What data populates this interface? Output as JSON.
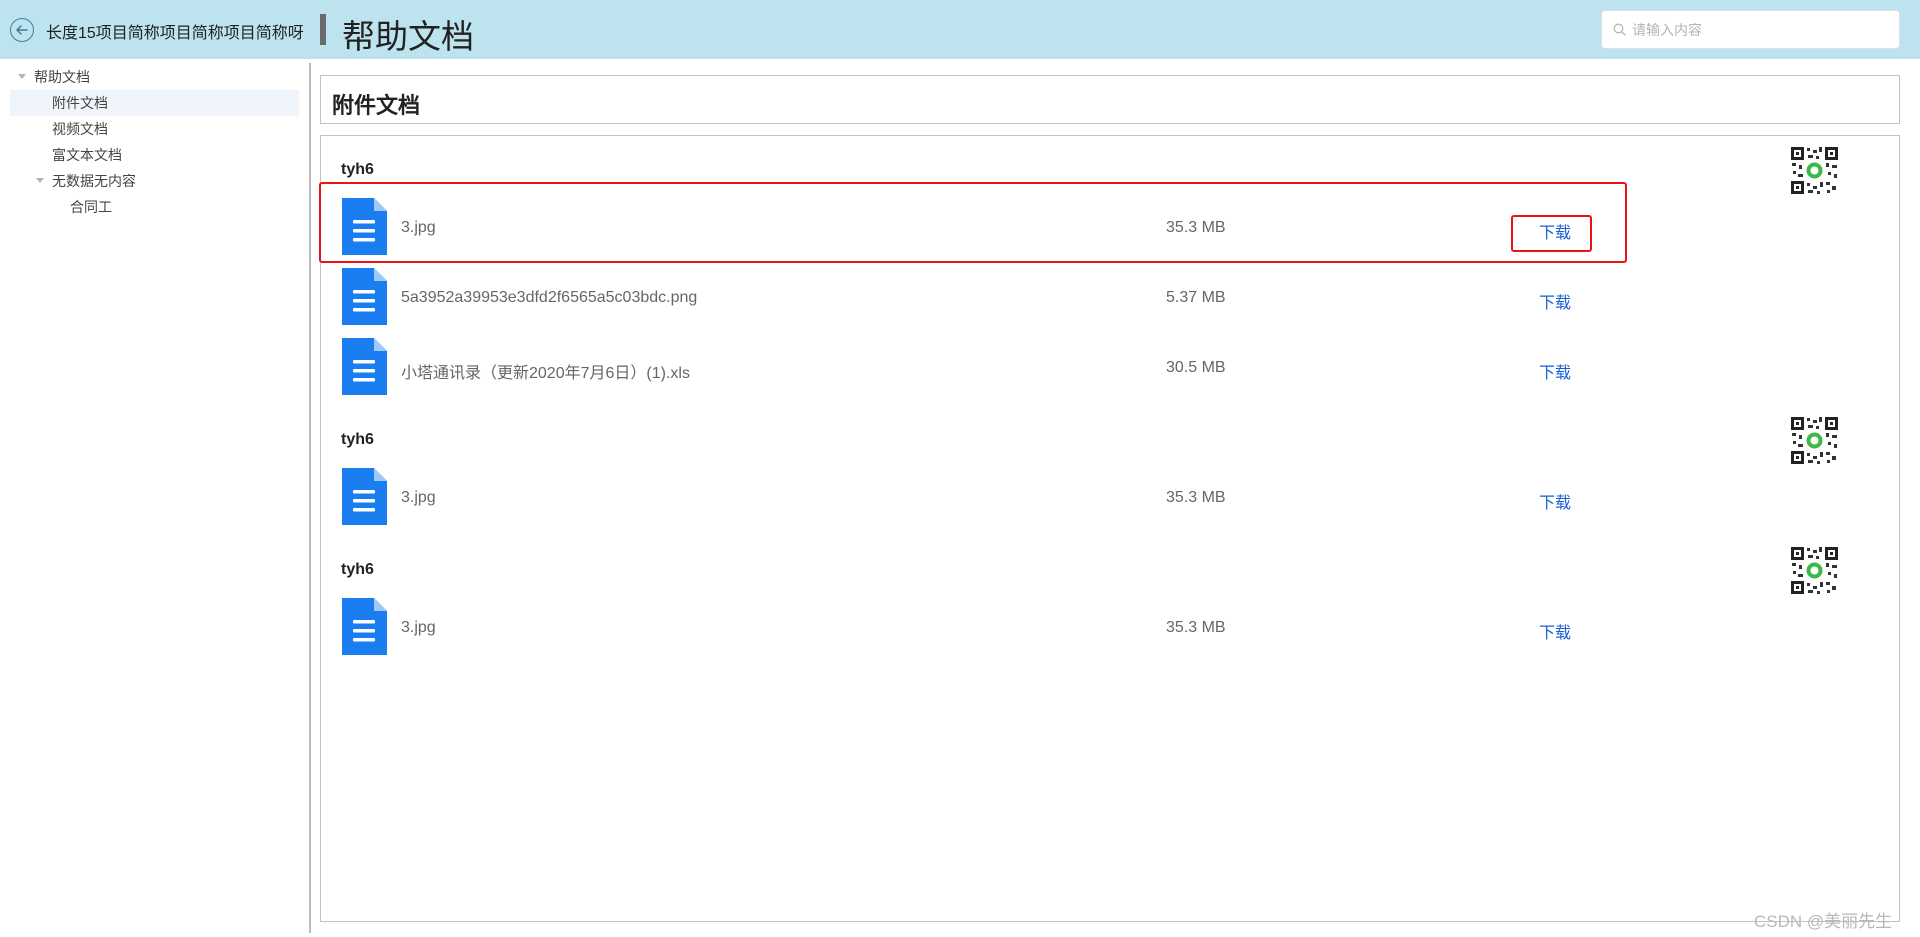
{
  "header": {
    "project_name": "长度15项目简称项目简称项目简称呀",
    "page_title": "帮助文档",
    "search_placeholder": "请输入内容"
  },
  "sidebar": {
    "items": [
      {
        "label": "帮助文档",
        "level": 0,
        "expanded": true,
        "active": false
      },
      {
        "label": "附件文档",
        "level": 1,
        "active": true
      },
      {
        "label": "视频文档",
        "level": 1,
        "active": false
      },
      {
        "label": "富文本文档",
        "level": 1,
        "active": false
      },
      {
        "label": "无数据无内容",
        "level": 1,
        "expanded": true,
        "active": false
      },
      {
        "label": "合同工",
        "level": 2,
        "active": false
      }
    ]
  },
  "main": {
    "title": "附件文档",
    "download_label": "下载",
    "groups": [
      {
        "name": "tyh6",
        "files": [
          {
            "name": "3.jpg",
            "size": "35.3 MB",
            "highlighted": true
          },
          {
            "name": "5a3952a39953e3dfd2f6565a5c03bdc.png",
            "size": "5.37 MB"
          },
          {
            "name": "小塔通讯录（更新2020年7月6日）(1).xls",
            "size": "30.5 MB"
          }
        ]
      },
      {
        "name": "tyh6",
        "files": [
          {
            "name": "3.jpg",
            "size": "35.3 MB"
          }
        ]
      },
      {
        "name": "tyh6",
        "files": [
          {
            "name": "3.jpg",
            "size": "35.3 MB"
          }
        ]
      }
    ]
  },
  "colors": {
    "header_bg": "#bde3ef",
    "file_icon": "#1a7ef0",
    "link": "#1a5fd6",
    "highlight": "#ee1111",
    "active_item_bg": "#f0f5fc"
  },
  "watermark": "CSDN @美丽先生"
}
